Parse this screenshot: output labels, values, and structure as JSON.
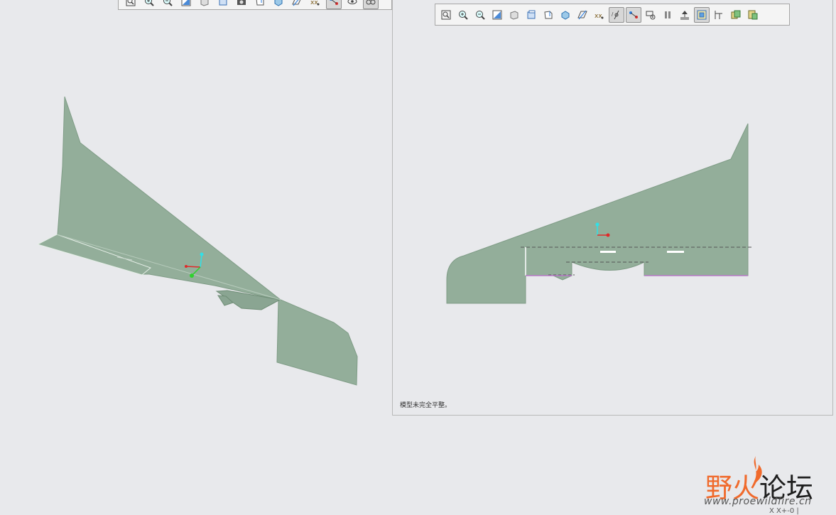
{
  "right_viewport": {
    "status_message": "模型未完全平整。"
  },
  "watermark": {
    "text_part1": "野火",
    "text_part2": "论坛",
    "url": "www.proewildfire.cn"
  },
  "coord_readout": "X  X+-0 |",
  "colors": {
    "surface": "#93ae9a",
    "surface_shade": "#8aa592",
    "edge": "#6f8d76",
    "axis_x": "#e02a2a",
    "axis_y": "#2fe1e8",
    "axis_z": "#2ed12e",
    "bend_line": "#555555",
    "watermark_orange": "#f06a2c"
  },
  "toolbar_right": {
    "buttons": [
      {
        "name": "refit-icon",
        "active": false
      },
      {
        "name": "zoom-in-icon",
        "active": false
      },
      {
        "name": "zoom-out-icon",
        "active": false
      },
      {
        "name": "repaint-icon",
        "active": false
      },
      {
        "name": "shading-icon",
        "active": false
      },
      {
        "name": "saved-views-icon",
        "active": false
      },
      {
        "name": "view-orient-icon",
        "active": false
      },
      {
        "name": "reoriented-view-icon",
        "active": false
      },
      {
        "name": "datum-plane-icon",
        "active": false
      },
      {
        "name": "datum-point-icon",
        "active": false
      },
      {
        "name": "datum-axis-icon",
        "active": true
      },
      {
        "name": "csys-icon",
        "active": true
      },
      {
        "name": "spin-center-icon",
        "active": false
      },
      {
        "name": "pause-icon",
        "active": false
      },
      {
        "name": "bend-order-icon",
        "active": false
      },
      {
        "name": "flat-state-icon",
        "active": true
      },
      {
        "name": "dimension-icon",
        "active": false
      },
      {
        "name": "copy-sheet-icon",
        "active": false
      },
      {
        "name": "paste-sheet-icon",
        "active": false
      }
    ]
  },
  "toolbar_left": {
    "buttons": [
      {
        "name": "refit-icon",
        "active": false
      },
      {
        "name": "zoom-in-icon",
        "active": false
      },
      {
        "name": "zoom-out-icon",
        "active": false
      },
      {
        "name": "repaint-icon",
        "active": false
      },
      {
        "name": "shading-icon",
        "active": false
      },
      {
        "name": "saved-views-icon",
        "active": false
      },
      {
        "name": "camera-icon",
        "active": false
      },
      {
        "name": "view-orient-icon",
        "active": false
      },
      {
        "name": "reoriented-view-icon",
        "active": false
      },
      {
        "name": "datum-plane-icon",
        "active": false
      },
      {
        "name": "datum-point-icon",
        "active": false
      },
      {
        "name": "csys-icon",
        "active": true
      },
      {
        "name": "eye-icon",
        "active": false
      },
      {
        "name": "glasses-icon",
        "active": true
      }
    ]
  }
}
